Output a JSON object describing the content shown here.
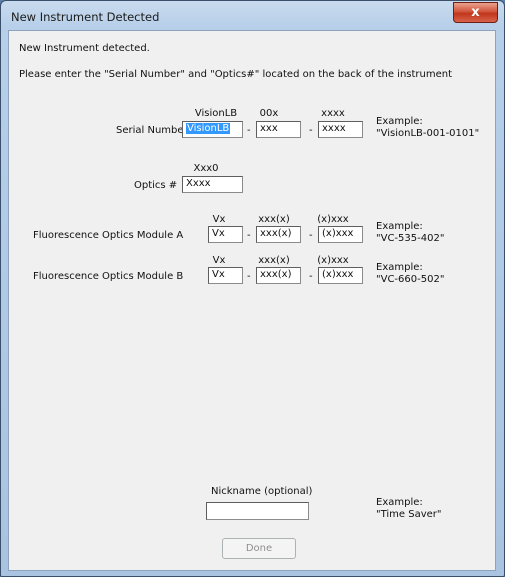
{
  "window": {
    "title": "New Instrument Detected",
    "close_label": "x"
  },
  "intro": {
    "line1": "New Instrument detected.",
    "line2": "Please enter the \"Serial Number\" and \"Optics#\" located on the back of the instrument"
  },
  "serial": {
    "label": "Serial Number",
    "headers": [
      "VisionLB",
      "00x",
      "xxxx"
    ],
    "values": [
      "VisionLB",
      "xxx",
      "xxxx"
    ],
    "example_label": "Example:",
    "example_value": "\"VisionLB-001-0101\""
  },
  "optics": {
    "label": "Optics #",
    "header": "Xxx0",
    "value": "Xxxx"
  },
  "module_a": {
    "label": "Fluorescence Optics Module A",
    "headers": [
      "Vx",
      "xxx(x)",
      "(x)xxx"
    ],
    "values": [
      "Vx",
      "xxx(x)",
      "(x)xxx"
    ],
    "example_label": "Example:",
    "example_value": "\"VC-535-402\""
  },
  "module_b": {
    "label": "Fluorescence Optics Module B",
    "headers": [
      "Vx",
      "xxx(x)",
      "(x)xxx"
    ],
    "values": [
      "Vx",
      "xxx(x)",
      "(x)xxx"
    ],
    "example_label": "Example:",
    "example_value": "\"VC-660-502\""
  },
  "nickname": {
    "label": "Nickname (optional)",
    "value": "",
    "example_label": "Example:",
    "example_value": "\"Time Saver\""
  },
  "separator": "-",
  "done_label": "Done",
  "colors": {
    "selection": "#3399ff",
    "titlebar": "#b7cfe9",
    "close": "#c0361c"
  }
}
